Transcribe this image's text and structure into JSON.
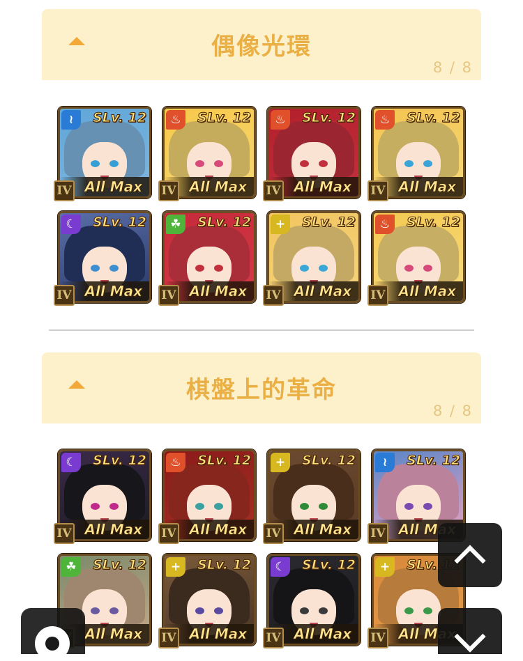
{
  "colors": {
    "header_bg": "#fdf1cc",
    "title": "#eab046",
    "count": "#e6c682",
    "toggle": "#f2a93a"
  },
  "sections": [
    {
      "title": "偶像光環",
      "count": "8 / 8",
      "cards": [
        {
          "skill_level": "SLv. 12",
          "rank": "IV",
          "status": "All Max",
          "element": "water",
          "element_icon": "water-icon"
        },
        {
          "skill_level": "SLv. 12",
          "rank": "IV",
          "status": "All Max",
          "element": "fire",
          "element_icon": "fire-icon"
        },
        {
          "skill_level": "SLv. 12",
          "rank": "IV",
          "status": "All Max",
          "element": "fire",
          "element_icon": "fire-icon"
        },
        {
          "skill_level": "SLv. 12",
          "rank": "IV",
          "status": "All Max",
          "element": "fire",
          "element_icon": "fire-icon"
        },
        {
          "skill_level": "SLv. 12",
          "rank": "IV",
          "status": "All Max",
          "element": "dark",
          "element_icon": "moon-icon"
        },
        {
          "skill_level": "SLv. 12",
          "rank": "IV",
          "status": "All Max",
          "element": "wind",
          "element_icon": "leaf-icon"
        },
        {
          "skill_level": "SLv. 12",
          "rank": "IV",
          "status": "All Max",
          "element": "light",
          "element_icon": "cross-icon"
        },
        {
          "skill_level": "SLv. 12",
          "rank": "IV",
          "status": "All Max",
          "element": "fire",
          "element_icon": "fire-icon"
        }
      ]
    },
    {
      "title": "棋盤上的革命",
      "count": "8 / 8",
      "cards": [
        {
          "skill_level": "SLv. 12",
          "rank": "IV",
          "status": "All Max",
          "element": "dark",
          "element_icon": "moon-icon"
        },
        {
          "skill_level": "SLv. 12",
          "rank": "IV",
          "status": "All Max",
          "element": "fire",
          "element_icon": "fire-icon"
        },
        {
          "skill_level": "SLv. 12",
          "rank": "IV",
          "status": "All Max",
          "element": "light",
          "element_icon": "cross-icon"
        },
        {
          "skill_level": "SLv. 12",
          "rank": "IV",
          "status": "All Max",
          "element": "water",
          "element_icon": "water-icon"
        },
        {
          "skill_level": "SLv. 12",
          "rank": "IV",
          "status": "All Max",
          "element": "wind",
          "element_icon": "leaf-icon"
        },
        {
          "skill_level": "SLv. 12",
          "rank": "IV",
          "status": "All Max",
          "element": "light",
          "element_icon": "cross-icon"
        },
        {
          "skill_level": "SLv. 12",
          "rank": "IV",
          "status": "All Max",
          "element": "dark",
          "element_icon": "moon-icon"
        },
        {
          "skill_level": "SLv. 12",
          "rank": "IV",
          "status": "All Max",
          "element": "light",
          "element_icon": "cross-icon"
        }
      ]
    }
  ],
  "controls": {
    "scroll_up_icon": "chevron-up-icon",
    "scroll_down_icon": "chevron-down-icon",
    "settings_icon": "gear-icon"
  }
}
